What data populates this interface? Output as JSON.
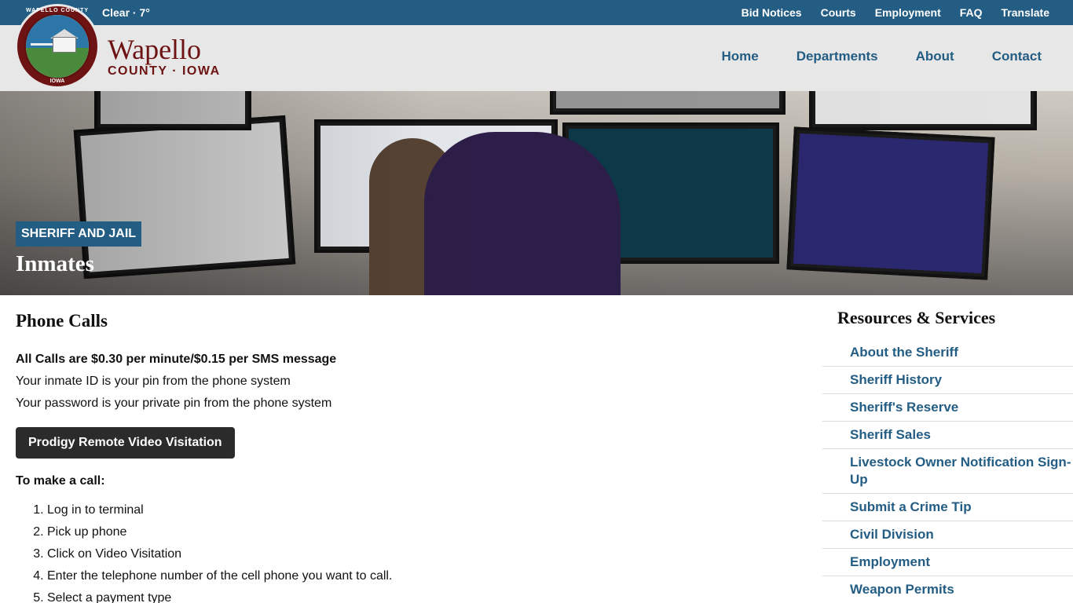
{
  "topbar": {
    "weather": "Clear · 7°",
    "links": [
      "Bid Notices",
      "Courts",
      "Employment",
      "FAQ",
      "Translate"
    ]
  },
  "brand": {
    "name": "Wapello",
    "subtitle": "COUNTY · IOWA",
    "seal_top": "WAPELLO COUNTY",
    "seal_bottom": "IOWA"
  },
  "nav": [
    "Home",
    "Departments",
    "About",
    "Contact"
  ],
  "hero": {
    "category": "SHERIFF AND JAIL",
    "title": "Inmates"
  },
  "main": {
    "heading": "Phone Calls",
    "rates": "All Calls are $0.30 per minute/$0.15 per SMS message",
    "inmate_id": "Your inmate ID is your pin from the phone system",
    "password": "Your password is your private pin from the phone system",
    "button": "Prodigy Remote Video Visitation",
    "make_call": "To make a call:",
    "steps": [
      "Log in to terminal",
      "Pick up phone",
      "Click on Video Visitation",
      "Enter the telephone number of the cell phone you want to call.",
      "Select a payment type"
    ]
  },
  "sidebar": {
    "title": "Resources & Services",
    "items": [
      "About the Sheriff",
      "Sheriff History",
      "Sheriff's Reserve",
      "Sheriff Sales",
      "Livestock Owner Notification Sign-Up",
      "Submit a Crime Tip",
      "Civil Division",
      "Employment",
      "Weapon Permits"
    ]
  },
  "colors": {
    "topbar": "#245d84",
    "brand": "#6d1313",
    "link": "#245d84",
    "button": "#2b2b2b"
  }
}
